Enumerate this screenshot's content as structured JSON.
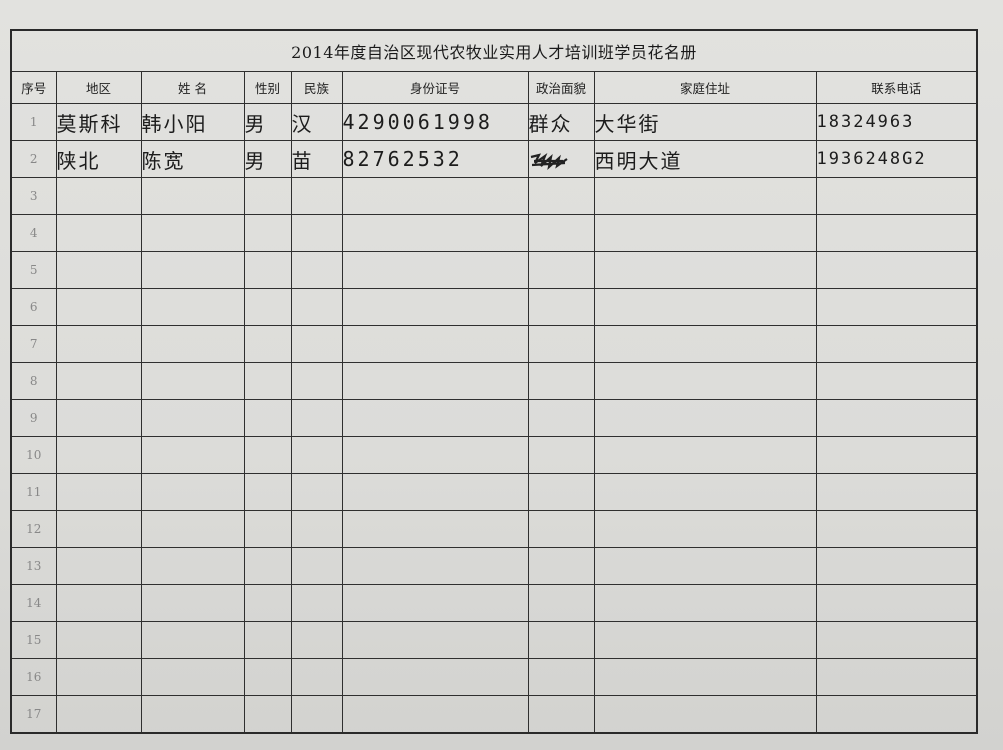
{
  "title": "2014年度自治区现代农牧业实用人才培训班学员花名册",
  "headers": [
    "序号",
    "地区",
    "姓 名",
    "性别",
    "民族",
    "身份证号",
    "政治面貌",
    "家庭住址",
    "联系电话"
  ],
  "rows": [
    {
      "num": "1",
      "region": "莫斯科",
      "name": "韩小阳",
      "gender": "男",
      "ethnicity": "汉",
      "id": "4290061998",
      "politics": "群众",
      "address": "大华街",
      "phone": "18324963"
    },
    {
      "num": "2",
      "region": "陕北",
      "name": "陈宽",
      "gender": "男",
      "ethnicity": "苗",
      "id": "82762532",
      "politics": "",
      "address": "西明大道",
      "phone": "1936248G2"
    },
    {
      "num": "3"
    },
    {
      "num": "4"
    },
    {
      "num": "5"
    },
    {
      "num": "6"
    },
    {
      "num": "7"
    },
    {
      "num": "8"
    },
    {
      "num": "9"
    },
    {
      "num": "10"
    },
    {
      "num": "11"
    },
    {
      "num": "12"
    },
    {
      "num": "13"
    },
    {
      "num": "14"
    },
    {
      "num": "15"
    },
    {
      "num": "16"
    },
    {
      "num": "17"
    }
  ]
}
